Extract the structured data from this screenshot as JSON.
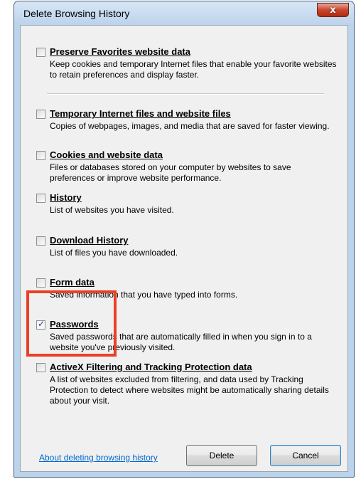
{
  "window": {
    "title": "Delete Browsing History",
    "close_glyph": "x"
  },
  "options": [
    {
      "label": "Preserve Favorites website data",
      "checked": false,
      "description": "Keep cookies and temporary Internet files that enable your favorite websites to retain preferences and display faster."
    },
    {
      "label": "Temporary Internet files and website files",
      "checked": false,
      "description": "Copies of webpages, images, and media that are saved for faster viewing."
    },
    {
      "label": "Cookies and website data",
      "checked": false,
      "description": "Files or databases stored on your computer by websites to save preferences or improve website performance."
    },
    {
      "label": "History",
      "checked": false,
      "description": "List of websites you have visited."
    },
    {
      "label": "Download History",
      "checked": false,
      "description": "List of files you have downloaded."
    },
    {
      "label": "Form data",
      "checked": false,
      "description": "Saved information that you have typed into forms."
    },
    {
      "label": "Passwords",
      "checked": true,
      "description": "Saved passwords that are automatically filled in when you sign in to a website you've previously visited."
    },
    {
      "label": "ActiveX Filtering and Tracking Protection data",
      "checked": false,
      "description": "A list of websites excluded from filtering, and data used by Tracking Protection to detect where websites might be automatically sharing details about your visit."
    }
  ],
  "footer": {
    "link": "About deleting browsing history",
    "delete_label": "Delete",
    "cancel_label": "Cancel"
  },
  "colors": {
    "highlight_box": "#ea4126",
    "link": "#0066cc",
    "close_button": "#c9452c"
  },
  "icons": {
    "check": "checkmark-icon",
    "close": "close-icon"
  }
}
